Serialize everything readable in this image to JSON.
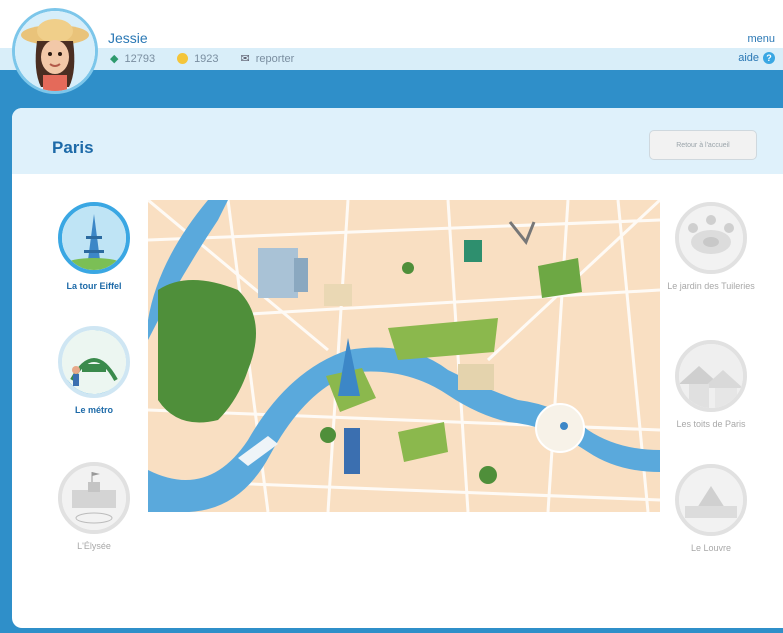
{
  "user": {
    "name": "Jessie",
    "gems": "12793",
    "coins": "1923",
    "report_label": "reporter"
  },
  "nav": {
    "menu_label": "menu",
    "help_label": "aide"
  },
  "page": {
    "title": "Paris",
    "back_button_label": "Retour à l'accueil"
  },
  "left_items": [
    {
      "label": "La tour Eiffel",
      "state": "active"
    },
    {
      "label": "Le métro",
      "state": "in-progress"
    },
    {
      "label": "L'Élysée",
      "state": "locked"
    }
  ],
  "right_items": [
    {
      "label": "Le jardin des Tuileries",
      "state": "locked"
    },
    {
      "label": "Les toits de Paris",
      "state": "locked"
    },
    {
      "label": "Le Louvre",
      "state": "locked"
    }
  ],
  "colors": {
    "accent": "#3aa7e3",
    "title": "#1d6aa8",
    "map_bg": "#f9dfc2",
    "river": "#5aa9dc",
    "park": "#4f8f3a"
  }
}
